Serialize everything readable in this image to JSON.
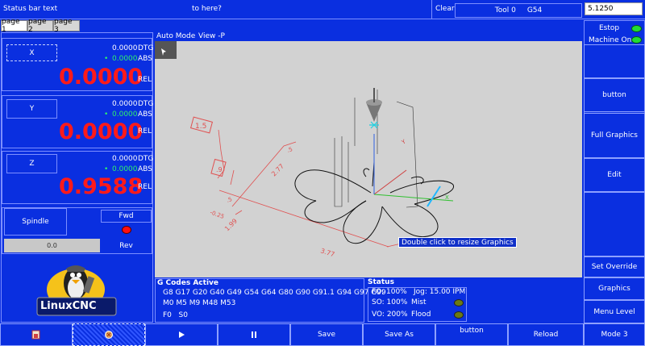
{
  "statusbar": {
    "left": "Status bar text",
    "center": "to here?",
    "clear": "Clear",
    "tool": "Tool 0",
    "wcs": "G54",
    "input_value": "5.1250"
  },
  "tabs": [
    "page 1",
    "page 2",
    "page 3"
  ],
  "dro": [
    {
      "axis": "X",
      "dtg": "0.0000",
      "dtg_label": "DTG",
      "abs": "0.0000",
      "abs_label": "ABS",
      "rel": "0.0000",
      "rel_label": "REL"
    },
    {
      "axis": "Y",
      "dtg": "0.0000",
      "dtg_label": "DTG",
      "abs": "0.0000",
      "abs_label": "ABS",
      "rel": "0.0000",
      "rel_label": "REL"
    },
    {
      "axis": "Z",
      "dtg": "0.0000",
      "dtg_label": "DTG",
      "abs": "0.0000",
      "abs_label": "ABS",
      "rel": "0.9588",
      "rel_label": "REL"
    }
  ],
  "spindle": {
    "label": "Spindle",
    "fwd": "Fwd",
    "rev": "Rev",
    "speed": "0.0"
  },
  "logo": {
    "text": "LinuxCNC"
  },
  "graphics": {
    "mode": "Auto Mode",
    "view": "View -P",
    "tooltip": "Double click to resize Graphics",
    "dims": [
      "1.5",
      ".9",
      ".5",
      ".5",
      "3.77",
      "2.77",
      "1.99",
      "-0.25"
    ]
  },
  "right_panel": {
    "estop": "Estop",
    "machine_on": "Machine On",
    "button": "button",
    "full_graphics": "Full Graphics",
    "edit": "Edit",
    "set_override": "Set Override",
    "graphics": "Graphics",
    "menu_level": "Menu Level",
    "mode": "Mode 3"
  },
  "gcodes": {
    "title": "G Codes Active",
    "line1": "G8 G17 G20 G40 G49 G54 G64 G80 G90 G91.1 G94 G97 G99",
    "line2": "M0 M5 M9 M48 M53",
    "line3": "F0   S0"
  },
  "status": {
    "title": "Status",
    "fo": "FO: 100%",
    "jog": "Jog: 15.00 IPM",
    "so": "SO: 100%",
    "mist": "Mist",
    "vo": "VO: 200%",
    "flood": "Flood"
  },
  "toolbar": {
    "save": "Save",
    "save_as": "Save As",
    "button": "button",
    "reload": "Reload"
  },
  "colors": {
    "bg": "#0a2fe0",
    "rel_red": "#ff1a1a",
    "abs_green": "#2ff26b",
    "led_green": "#22dd33",
    "led_red": "#ff1010",
    "led_olive": "#6b7a12",
    "tooltip_bg": "#1030c8"
  }
}
